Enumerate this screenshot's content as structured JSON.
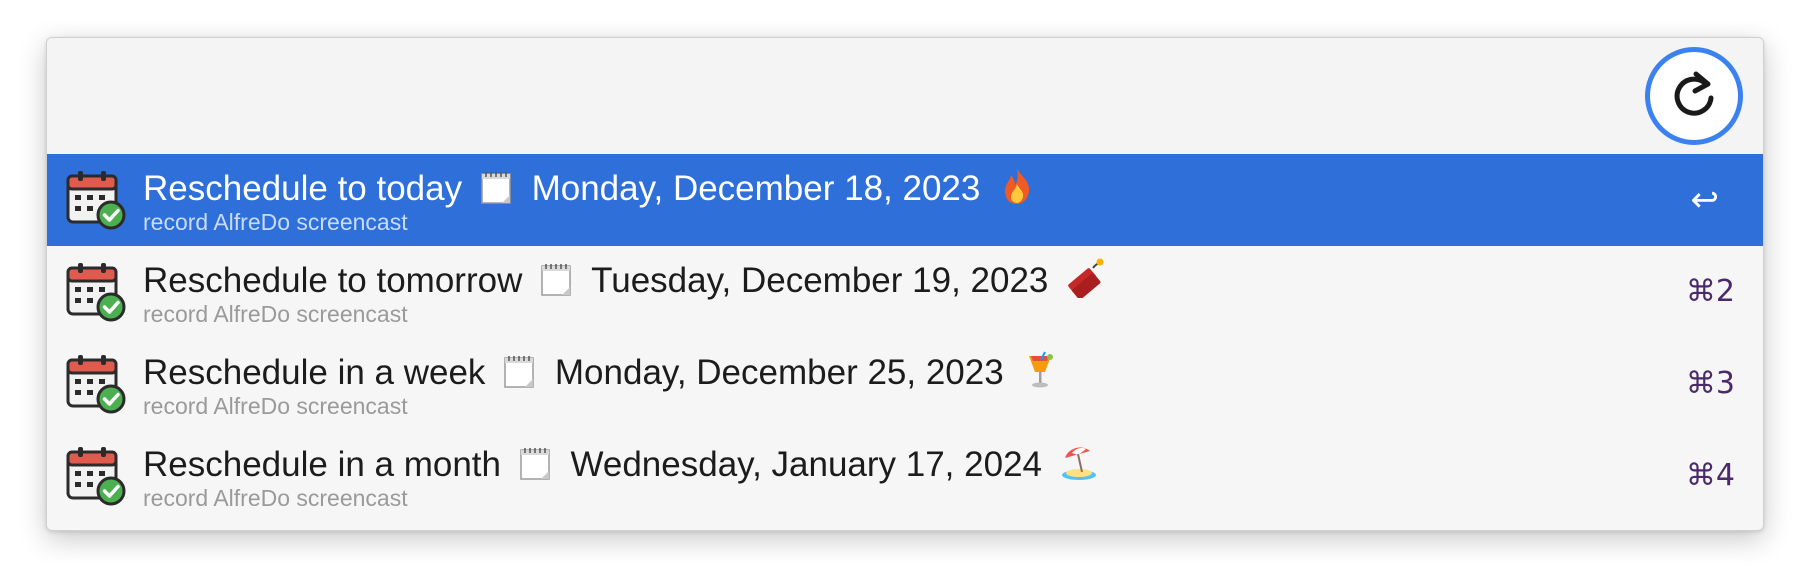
{
  "search": {
    "value": "",
    "placeholder": ""
  },
  "header": {
    "refresh_icon": "refresh-icon",
    "accent_color": "#3b82f0"
  },
  "colors": {
    "selected_row": "#2e6fd9",
    "shortcut_text": "#4a2a6a"
  },
  "results": [
    {
      "title_prefix": "Reschedule to today",
      "title_date": "Monday, December 18, 2023",
      "emoji": "fire",
      "subtitle": "record AlfreDo screencast",
      "shortcut": "↩",
      "selected": true
    },
    {
      "title_prefix": "Reschedule to tomorrow",
      "title_date": "Tuesday, December 19, 2023",
      "emoji": "dynamite",
      "subtitle": "record AlfreDo screencast",
      "shortcut": "⌘2",
      "selected": false
    },
    {
      "title_prefix": "Reschedule in a week",
      "title_date": "Monday, December 25, 2023",
      "emoji": "tropical-drink",
      "subtitle": "record AlfreDo screencast",
      "shortcut": "⌘3",
      "selected": false
    },
    {
      "title_prefix": "Reschedule in a month",
      "title_date": "Wednesday, January 17, 2024",
      "emoji": "beach-umbrella",
      "subtitle": "record AlfreDo screencast",
      "shortcut": "⌘4",
      "selected": false
    }
  ]
}
